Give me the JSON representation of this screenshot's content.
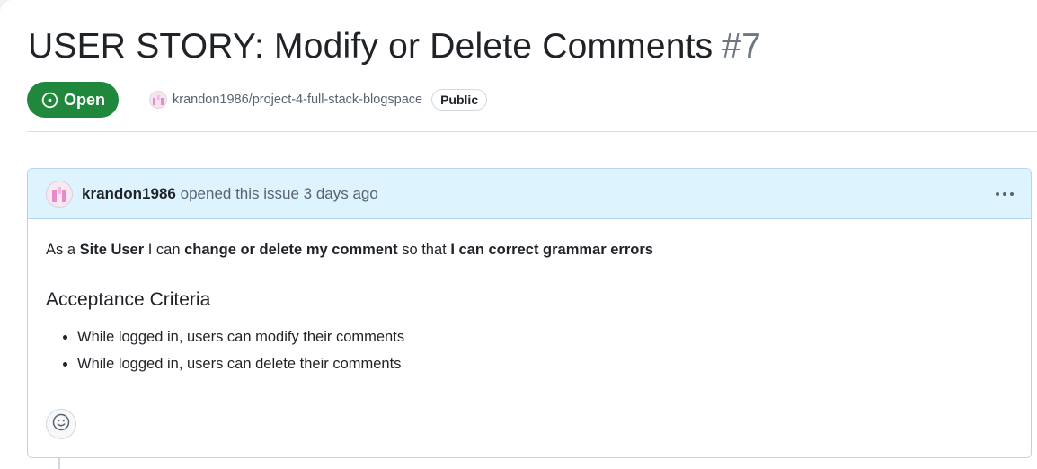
{
  "issue": {
    "title": "USER STORY: Modify or Delete Comments",
    "number": "#7",
    "state": "Open",
    "state_color": "#1f883d",
    "repo": "krandon1986/project-4-full-stack-blogspace",
    "visibility": "Public"
  },
  "comment": {
    "author": "krandon1986",
    "action": "opened this issue 3 days ago",
    "header_bg": "#ddf4ff",
    "story": {
      "p1": "As a ",
      "b1": "Site User",
      "p2": " I can ",
      "b2": "change or delete my comment",
      "p3": " so that ",
      "b3": "I can correct grammar errors"
    },
    "criteria_heading": "Acceptance Criteria",
    "criteria": [
      "While logged in, users can modify their comments",
      "While logged in, users can delete their comments"
    ],
    "icons": {
      "menu": "kebab-horizontal-icon",
      "reaction": "smiley-icon",
      "state": "issue-opened-icon"
    }
  }
}
